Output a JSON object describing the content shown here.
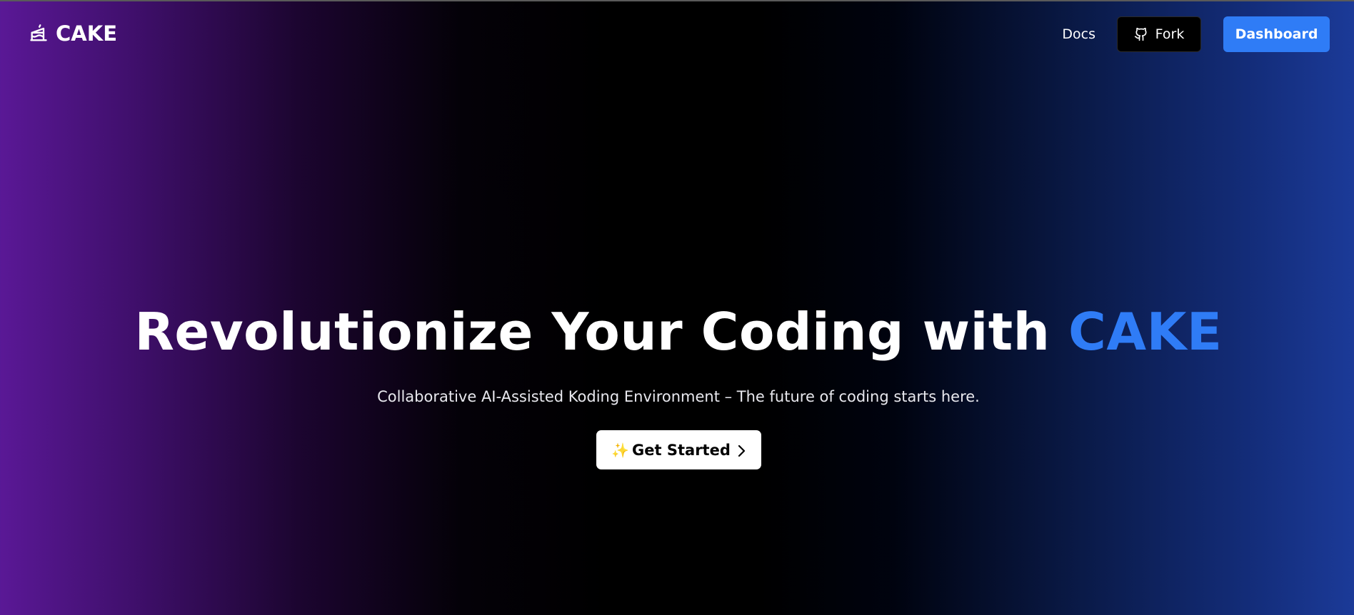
{
  "header": {
    "brand": {
      "name": "CAKE",
      "icon": "cake-icon"
    },
    "nav": {
      "docs_label": "Docs",
      "fork_label": "Fork",
      "fork_icon": "github-icon",
      "dashboard_label": "Dashboard"
    }
  },
  "hero": {
    "title_main": "Revolutionize Your Coding with ",
    "title_accent": "CAKE",
    "subtitle": "Collaborative AI-Assisted Koding Environment – The future of coding starts here.",
    "cta": {
      "icon": "sparkles-icon",
      "label": "Get Started",
      "trailing_icon": "chevron-right-icon"
    }
  },
  "colors": {
    "accent": "#2f7cf6",
    "cta_background": "#ffffff",
    "fork_background": "#000000",
    "gradient_left": "#5a1896",
    "gradient_center": "#000000",
    "gradient_right": "#1b3a98"
  }
}
